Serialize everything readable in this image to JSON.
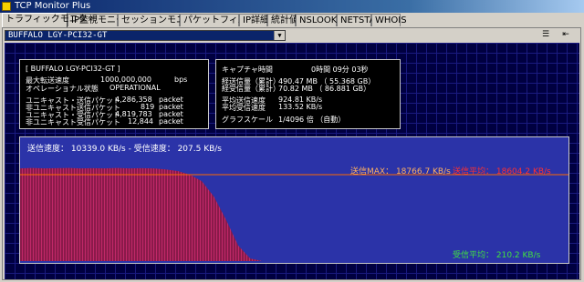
{
  "window": {
    "title": "TCP Monitor Plus"
  },
  "tabs": [
    {
      "label": "トラフィックモニター",
      "active": true
    },
    {
      "label": "IP監視モニター"
    },
    {
      "label": "セッションモニター"
    },
    {
      "label": "パケットフィルター"
    },
    {
      "label": "IP詳細"
    },
    {
      "label": "統計値"
    },
    {
      "label": "NSLOOKUP"
    },
    {
      "label": "NETSTAT"
    },
    {
      "label": "WHOIS"
    }
  ],
  "adapter": {
    "selected": "BUFFALO LGY-PCI32-GT"
  },
  "toolbar": {
    "menu_icon": "list-icon",
    "pin_icon": "pin-icon"
  },
  "info_box": {
    "name": "[ BUFFALO LGY-PCI32-GT ]",
    "rows": [
      {
        "label": "最大転送速度",
        "value": "1000,000,000",
        "unit": "bps"
      },
      {
        "label": "オペレーショナル状態",
        "value": "OPERATIONAL",
        "unit": ""
      },
      {
        "label": "ユニキャスト・送信パケット",
        "value": "4,286,358",
        "unit": "packet"
      },
      {
        "label": "非ユニキャスト送信パケット",
        "value": "819",
        "unit": "packet"
      },
      {
        "label": "ユニキャスト・受信パケット",
        "value": "4,819,783",
        "unit": "packet"
      },
      {
        "label": "非ユニキャスト受信パケット",
        "value": "12,844",
        "unit": "packet"
      }
    ]
  },
  "capture_box": {
    "rows": [
      {
        "label": "キャプチャ時間",
        "value": "0時間 09分 03秒"
      },
      {
        "label": "経送信量（累計）",
        "value": "490.47 MB （ 55.368 GB）"
      },
      {
        "label": "経受信量（累計）",
        "value": "70.82 MB （ 86.881 GB）"
      },
      {
        "label": "平均送信速度",
        "value": "924.81 KB/s"
      },
      {
        "label": "平均受信速度",
        "value": "133.52 KB/s"
      },
      {
        "label": "グラフスケール",
        "value": "1/4096 倍  （自動）"
      }
    ]
  },
  "graph": {
    "send_label": "送信速度： 10339.0 KB/s  -  受信速度：  207.5 KB/s",
    "max_label": "送信MAX： 18766.7 KB/s",
    "send_avg_label": "送信平均： 18604.2 KB/s",
    "recv_avg_label": "受信平均：   210.2 KB/s",
    "colors": {
      "background": "#2b33a8",
      "send": "#8a1a4a",
      "max_line": "#ff6a00",
      "send_avg": "#ff3030",
      "recv_avg": "#40e040",
      "text": "#ffffff"
    }
  },
  "chart_data": {
    "type": "area",
    "title": "",
    "series": [
      {
        "name": "送信",
        "values": [
          18000,
          18100,
          18000,
          18050,
          18100,
          18000,
          18050,
          18000,
          18100,
          18000,
          18050,
          18000,
          17800,
          17500,
          16800,
          15500,
          12500,
          8000,
          3000,
          500,
          0,
          0,
          0,
          0,
          0,
          0,
          0,
          0,
          0,
          0,
          0,
          0,
          0
        ]
      }
    ],
    "ylim": [
      0,
      20500
    ]
  }
}
